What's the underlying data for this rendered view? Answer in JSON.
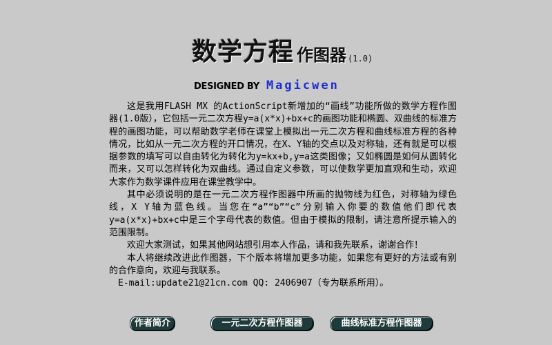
{
  "header": {
    "title_main": "数学方程",
    "title_sub": "作图器",
    "version": "(1.0)",
    "credit_prefix": "DESIGNED BY",
    "credit_author": "Magicwen"
  },
  "content": {
    "paragraphs": [
      "这是我用FLASH MX 的ActionScript新增加的“画线”功能所做的数学方程作图器(1.0版），它包括一元二次方程y=a(x*x)+bx+c的画图功能和椭圆、双曲线的标准方程的画图功能，可以帮助数学老师在课堂上模拟出一元二次方程和曲线标准方程的各种情况，比如从一元二次方程的开口情况，在X、Y轴的交点以及对称轴，还有就是可以根据参数的填写可以自由转化为转化为y=kx+b,y=a这类图像；又如椭圆是如何从圆转化而来，又可以怎样转化为双曲线。通过自定义参数，可以使数学更加直观和生动，欢迎大家作为数学课件应用在课堂教学中。",
      "其中必须说明的是在一元二次方程作图器中所画的抛物线为红色，对称轴为绿色线，X Y轴为蓝色线。当您在“a”“b”“c”分别输入你要的数值他们即代表y=a(x*x)+bx+c中是三个字母代表的数值。但由于模拟的限制，请注意所提示输入的范围限制。",
      "欢迎大家测试，如果其他网站想引用本人作品，请和我先联系，谢谢合作！",
      "本人将继续改进此作图器，下个版本将增加更多功能，如果您有更好的方法或有别的合作意向，欢迎与我联系。"
    ],
    "contact": "E-mail:update21@21cn.com  QQ: 2406907（专为联系所用）。"
  },
  "buttons": {
    "author_intro": "作者简介",
    "quadratic_plotter": "一元二次方程作图器",
    "curve_plotter": "曲线标准方程作图器"
  },
  "colors": {
    "background": "#c9c9c9",
    "button_bg": "#1f3a3a",
    "author_blue": "#1a2bd0"
  }
}
